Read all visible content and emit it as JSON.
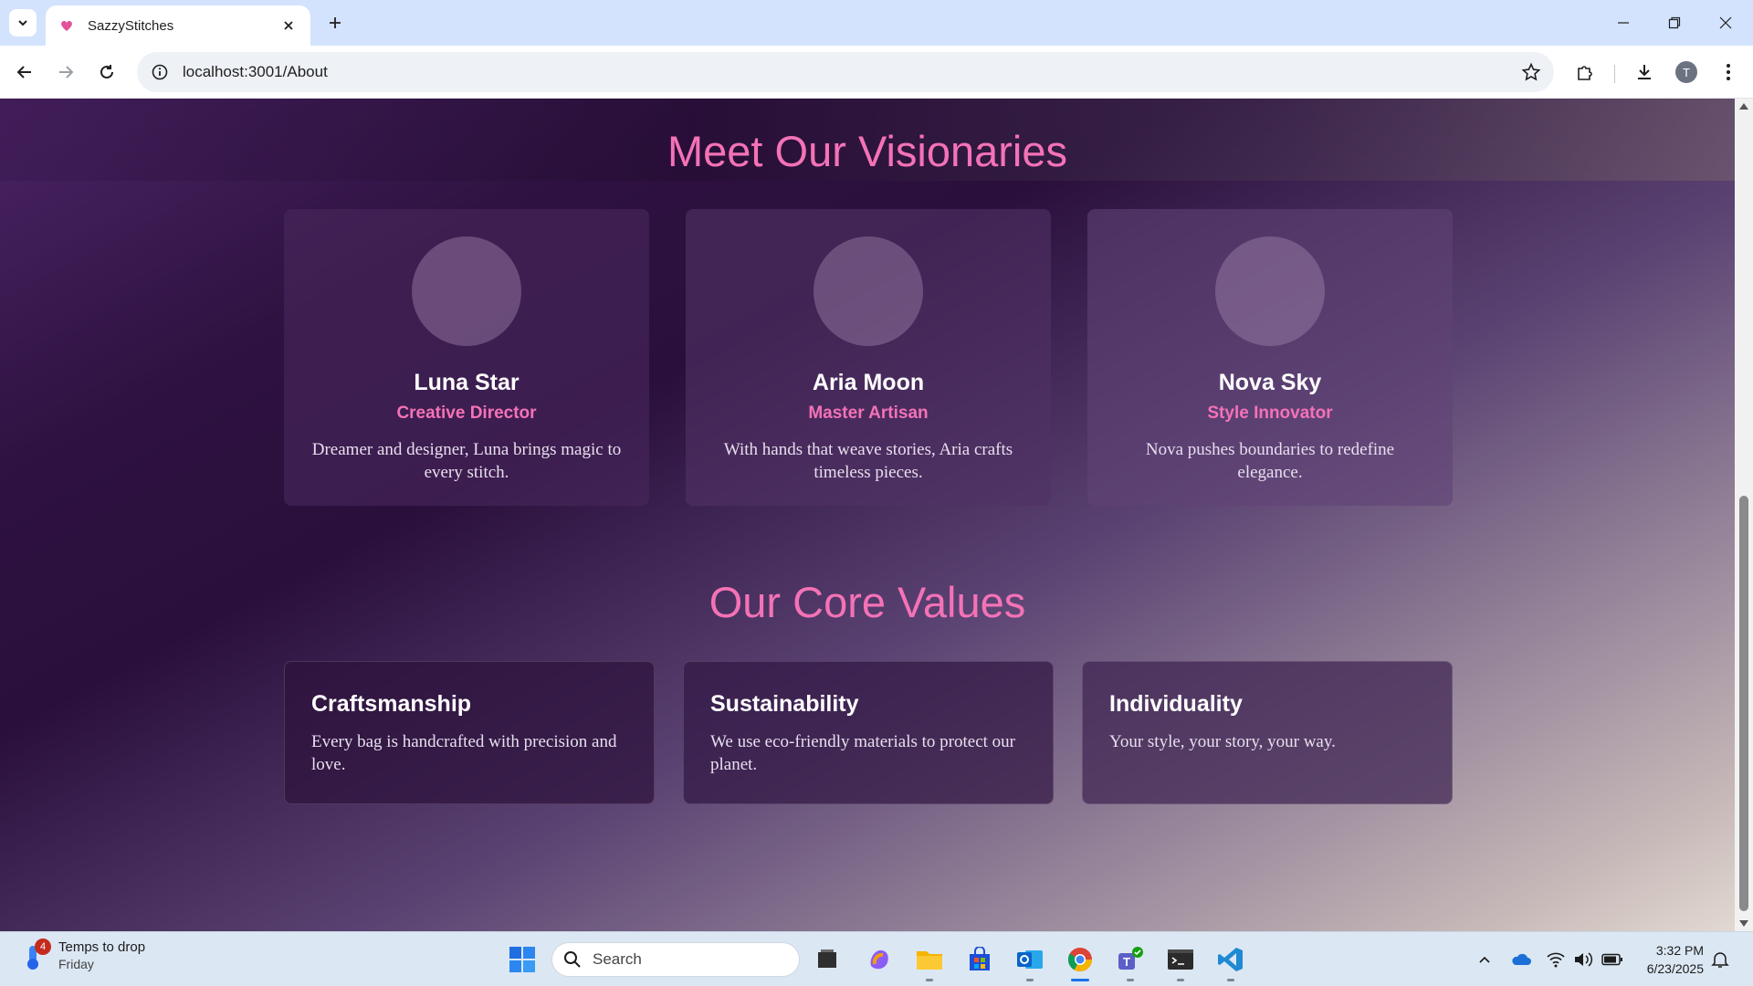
{
  "browser": {
    "tab_title": "SazzyStitches",
    "url": "localhost:3001/About",
    "profile_initial": "T"
  },
  "page": {
    "visionaries_heading": "Meet Our Visionaries",
    "team": [
      {
        "name": "Luna Star",
        "role": "Creative Director",
        "bio": "Dreamer and designer, Luna brings magic to every stitch."
      },
      {
        "name": "Aria Moon",
        "role": "Master Artisan",
        "bio": "With hands that weave stories, Aria crafts timeless pieces."
      },
      {
        "name": "Nova Sky",
        "role": "Style Innovator",
        "bio": "Nova pushes boundaries to redefine elegance."
      }
    ],
    "values_heading": "Our Core Values",
    "values": [
      {
        "title": "Craftsmanship",
        "desc": "Every bag is handcrafted with precision and love."
      },
      {
        "title": "Sustainability",
        "desc": "We use eco-friendly materials to protect our planet."
      },
      {
        "title": "Individuality",
        "desc": "Your style, your story, your way."
      }
    ]
  },
  "taskbar": {
    "weather_badge": "4",
    "weather_title": "Temps to drop",
    "weather_sub": "Friday",
    "search_label": "Search",
    "time": "3:32 PM",
    "date": "6/23/2025"
  },
  "colors": {
    "accent_pink": "#f472b6",
    "browser_frame": "#d3e3fd",
    "taskbar": "#dbe7f3"
  }
}
